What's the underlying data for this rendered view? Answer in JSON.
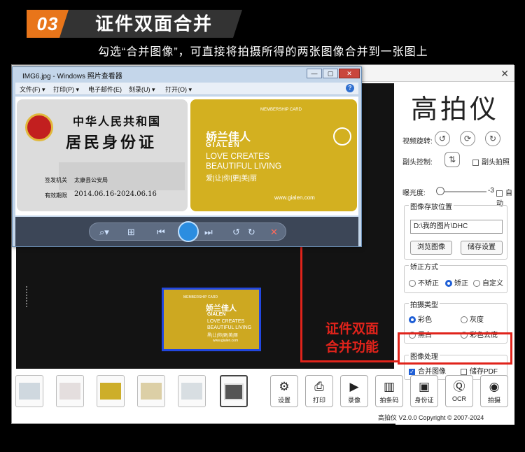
{
  "header": {
    "step_number": "03",
    "title": "证件双面合并",
    "subtitle": "勾选“合并图像”，可直接将拍摄所得的两张图像合并到一张图上"
  },
  "viewer": {
    "title": "IMG6.jpg - Windows 照片查看器",
    "controls": [
      "—",
      "▢",
      "✕"
    ],
    "menus": [
      "文件(F) ▾",
      "打印(P) ▾",
      "电子邮件(E)",
      "刻录(U) ▾",
      "打开(O) ▾"
    ],
    "help": "?",
    "id_card": {
      "line1": "中华人民共和国",
      "line2": "居民身份证",
      "authority_label": "签发机关",
      "authority": "太康县公安局",
      "validity_label": "有效期限",
      "validity": "2014.06.16-2024.06.16"
    },
    "member_card": {
      "label": "MEMBERSHIP CARD",
      "brand_cn": "娇兰佳人",
      "brand_en": "GIALEN",
      "slogan1": "LOVE CREATES",
      "slogan2": "BEAUTIFUL LIVING",
      "slogan_cn": "爱|让|你|更|美|丽",
      "url": "www.gialen.com"
    },
    "nav_icons": [
      "⌕▾",
      "⊞",
      "⏮",
      "⏭",
      "↺",
      "↻",
      "✕"
    ]
  },
  "preview_card": {
    "label": "MEMBERSHIP CARD",
    "brand_cn": "娇兰佳人",
    "brand_en": "GIALEN",
    "slogan1": "LOVE CREATES",
    "slogan2": "BEAUTIFUL LIVING",
    "slogan_cn": "黑|让|你|更|美|丽",
    "url": "www.gialen.com"
  },
  "app": {
    "close": "✕",
    "brand": "高拍仪",
    "video_rotate_label": "视频旋转:",
    "sub_camera_label": "副头控制:",
    "sub_camera_shot": "副头拍照",
    "exposure_label": "曝光度:",
    "exposure_value": "-3",
    "auto_label": "自动",
    "save_group": {
      "title": "图像存放位置",
      "path": "D:\\我的图片\\DHC",
      "browse": "浏览图像",
      "settings": "储存设置"
    },
    "correction_group": {
      "title": "矫正方式",
      "options": [
        "不矫正",
        "矫正",
        "自定义"
      ],
      "selected": "矫正"
    },
    "shoot_group": {
      "title": "拍摄类型",
      "options": [
        "彩色",
        "灰度",
        "黑白",
        "彩色去底"
      ],
      "selected": "彩色"
    },
    "process_group": {
      "title": "图像处理",
      "merge": "合并图像",
      "merge_checked": true,
      "save_pdf": "储存PDF",
      "save_pdf_checked": false
    },
    "toolbar": [
      {
        "icon": "⚙",
        "label": "设置"
      },
      {
        "icon": "⎙",
        "label": "打印"
      },
      {
        "icon": "▶",
        "label": "录像"
      },
      {
        "icon": "▥",
        "label": "拍条码"
      },
      {
        "icon": "▣",
        "label": "身份证"
      },
      {
        "icon": "Ⓠ",
        "label": "OCR"
      },
      {
        "icon": "◉",
        "label": "拍摄"
      }
    ],
    "copyright": "高拍仪 V2.0.0 Copyright © 2007-2024"
  },
  "annotation": {
    "line1": "证件双面",
    "line2": "合并功能"
  },
  "colors": {
    "accent_orange": "#e8751a",
    "annotation_red": "#e0231b",
    "selection_blue": "#2247e0",
    "card_gold": "#cda821"
  }
}
